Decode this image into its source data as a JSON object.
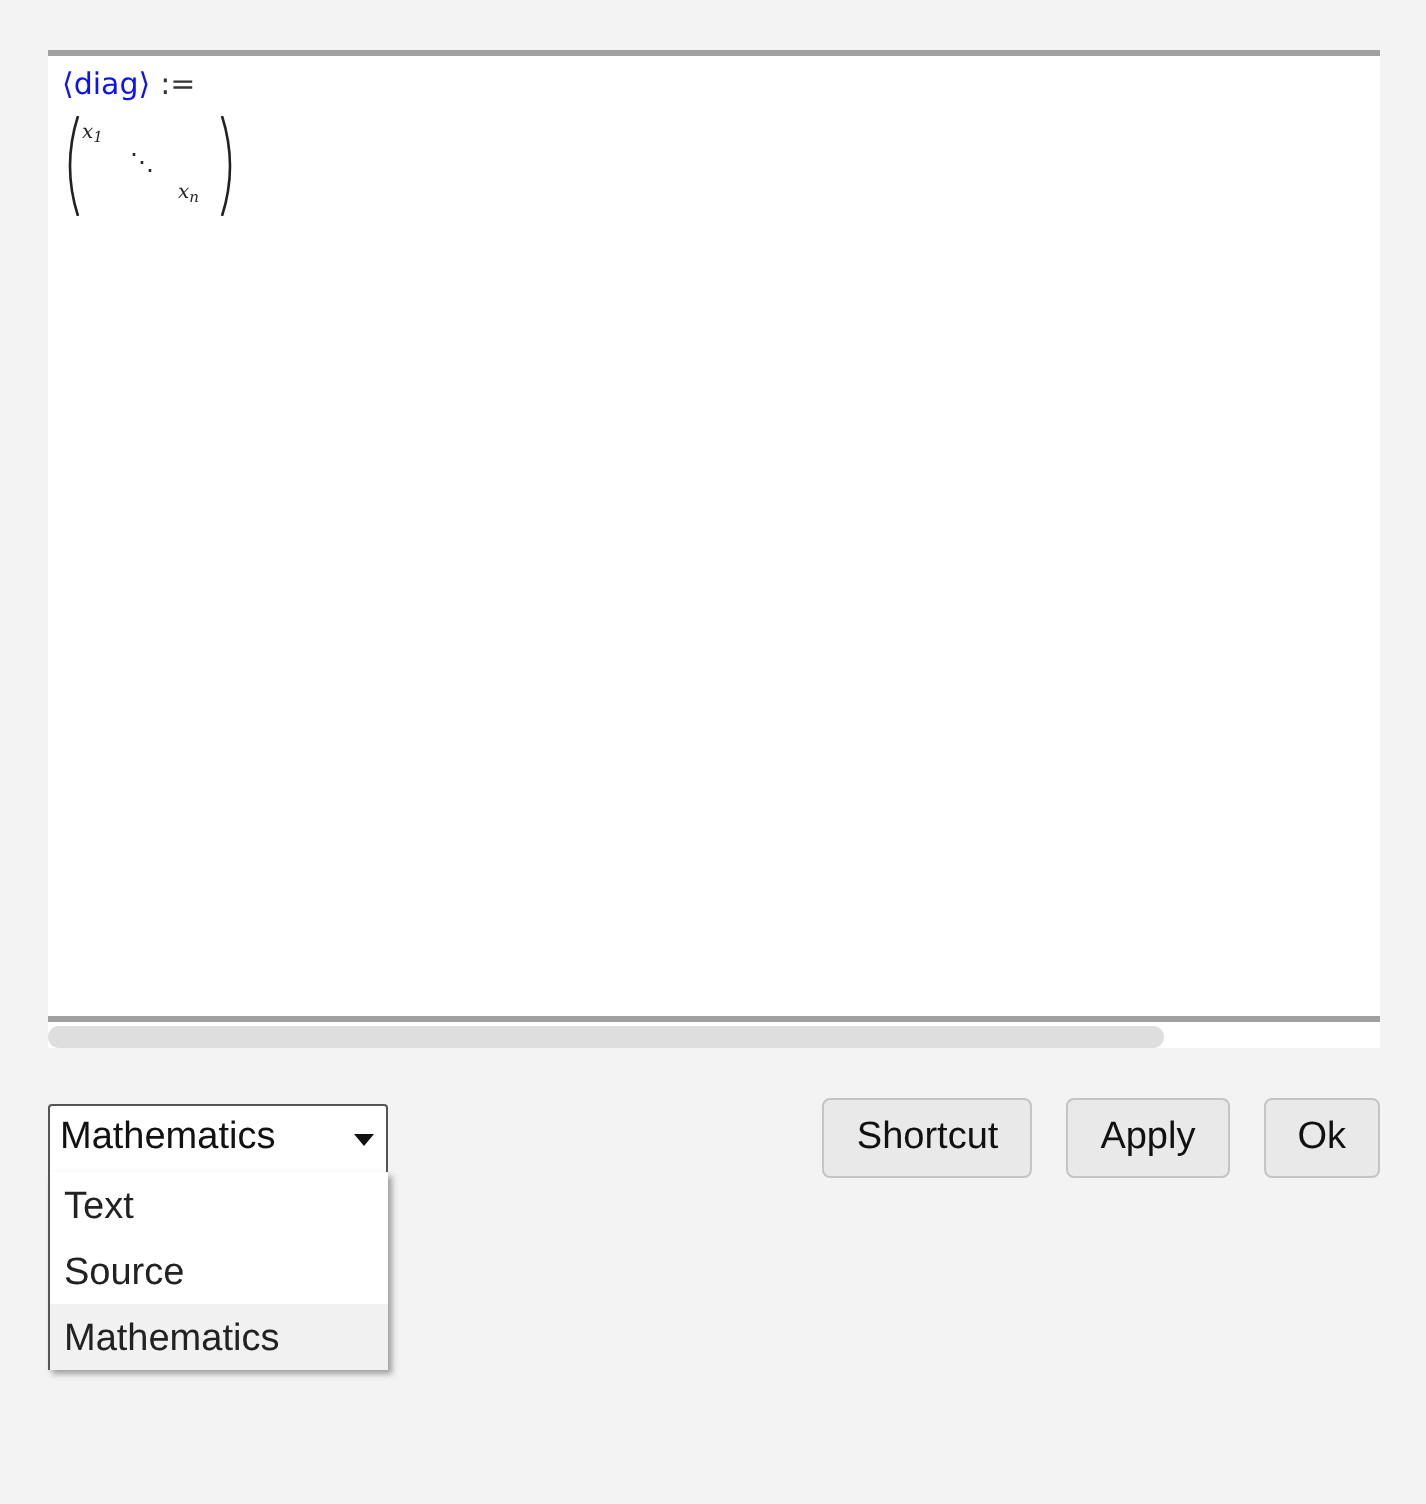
{
  "editor": {
    "definition": {
      "name": "⟨diag⟩",
      "operator": ":="
    },
    "matrix": {
      "diagonal": [
        "x$_{1}$",
        "⋱",
        "x$_{n}$"
      ]
    }
  },
  "mode_select": {
    "value": "Mathematics",
    "expanded": true,
    "options": [
      {
        "label": "Text",
        "selected": false
      },
      {
        "label": "Source",
        "selected": false
      },
      {
        "label": "Mathematics",
        "selected": true
      }
    ]
  },
  "buttons": [
    "Shortcut",
    "Apply",
    "Ok"
  ]
}
